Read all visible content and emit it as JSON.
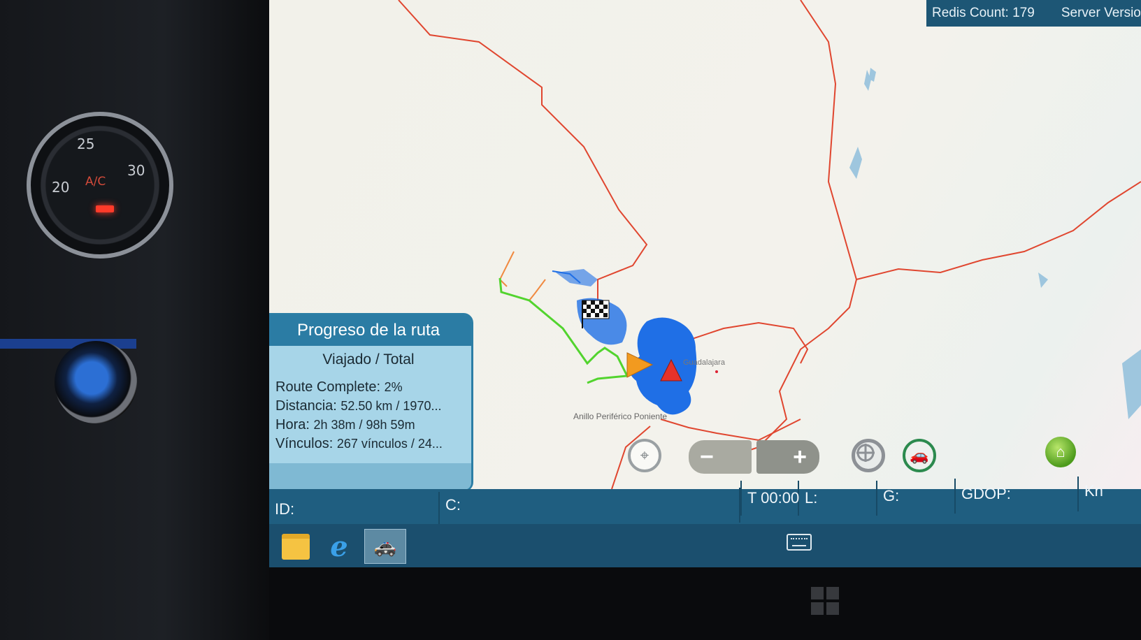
{
  "dashboard": {
    "ac_label": "A/C",
    "ac_temps": [
      "20",
      "25",
      "30"
    ]
  },
  "redis": {
    "count_label": "Redis Count: 179",
    "server_label": "Server Version"
  },
  "map": {
    "city_label": "Guadalajara",
    "road_label": "Anillo Periférico Poniente"
  },
  "route_progress": {
    "title": "Progreso de la ruta",
    "subtitle": "Viajado / Total",
    "route_complete_label": "Route Complete:",
    "route_complete_value": "2%",
    "distance_label": "Distancia:",
    "distance_value": "52.50 km / 1970...",
    "time_label": "Hora:",
    "time_value": "2h 38m / 98h 59m",
    "links_label": "Vínculos:",
    "links_value": "267 vínculos / 24..."
  },
  "controls": {
    "zoom_out": "−",
    "zoom_in": "+"
  },
  "status_bar": {
    "id": "ID:",
    "c": "C:",
    "t": "T 00:00",
    "l": "L:",
    "g": "G:",
    "gdop": "GDOP:",
    "kn": "Kn"
  },
  "taskbar": {
    "apps": [
      "file-explorer",
      "internet-explorer",
      "navigation-app"
    ]
  },
  "colors": {
    "status_bar": "#1f5e80",
    "panel_bg": "#a7d5e8",
    "route_red": "#e0462f",
    "route_green": "#52d42e",
    "coverage_blue": "#1f6fe6"
  }
}
